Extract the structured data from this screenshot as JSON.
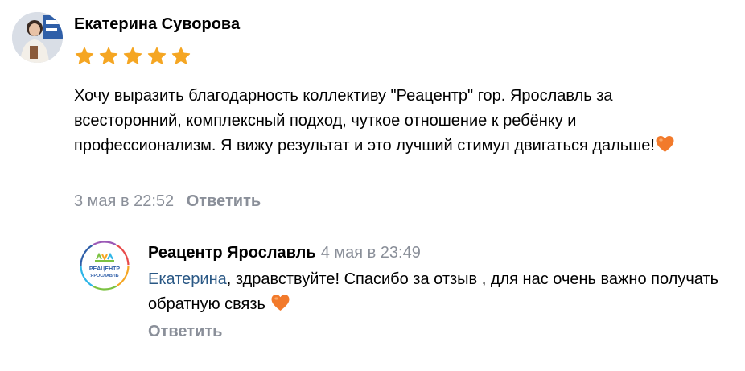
{
  "review": {
    "author": "Екатерина Суворова",
    "rating": 5,
    "rating_max": 5,
    "text": "Хочу выразить благодарность коллективу \"Реацентр\" гор. Ярославль за всесторонний, комплексный подход, чуткое отношение к ребёнку и профессионализм. Я вижу результат и это лучший стимул двигаться дальше!",
    "date": "3 мая в 22:52",
    "reply_label": "Ответить"
  },
  "reply": {
    "author": "Реацентр Ярославль",
    "date": "4 мая в 23:49",
    "mention": "Екатерина",
    "text": ", здравствуйте! Спасибо за отзыв , для нас очень важно получать обратную связь ",
    "reply_label": "Ответить",
    "logo_text_line1": "РЕАЦЕНТР",
    "logo_text_line2": "ЯРОСЛАВЛЬ"
  },
  "colors": {
    "star": "#f5a623",
    "meta_gray": "#8a8f99",
    "mention_blue": "#2a5885",
    "heart": "#f27a2b"
  },
  "icons": {
    "star": "star-icon",
    "heart": "orange-heart-emoji"
  }
}
